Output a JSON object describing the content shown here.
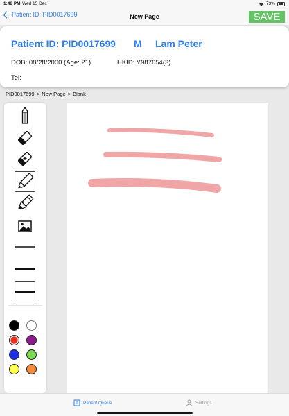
{
  "status_bar": {
    "time": "1:48 PM",
    "date": "Wed 15 Dec",
    "battery": "73%"
  },
  "nav": {
    "back_label": "Patient ID: PID0017699",
    "title": "New Page",
    "save_label": "SAVE"
  },
  "patient": {
    "id_line": "Patient ID: PID0017699",
    "sex": "M",
    "name": "Lam Peter",
    "dob": "DOB: 08/28/2000 (Age: 21)",
    "hkid": "HKID: Y987654(3)",
    "tel": "Tel:"
  },
  "breadcrumb": {
    "items": [
      "PID0017699",
      "New Page",
      "Blank"
    ],
    "separator": ">"
  },
  "toolbar": {
    "tools": [
      "pencil-icon",
      "eraser-icon",
      "area-eraser-icon",
      "marker-icon",
      "highlighter-icon",
      "image-icon",
      "thin-line-icon",
      "medium-line-icon",
      "thick-line-icon"
    ],
    "selected_tool": "marker-icon",
    "undo_icon": "undo-icon",
    "redo_icon": "redo-icon",
    "colors": [
      "#000000",
      "#ffffff",
      "#e8321e",
      "#8b1a8b",
      "#1a2ee8",
      "#7ed957",
      "#ffff4d",
      "#f08a3c"
    ],
    "selected_color": "#e8321e"
  },
  "canvas": {
    "stroke_color": "#f0a6a6"
  },
  "tabs": [
    {
      "label": "Patient Queue",
      "icon": "patient-queue-icon",
      "active": true
    },
    {
      "label": "Settings",
      "icon": "settings-icon",
      "active": false
    }
  ]
}
